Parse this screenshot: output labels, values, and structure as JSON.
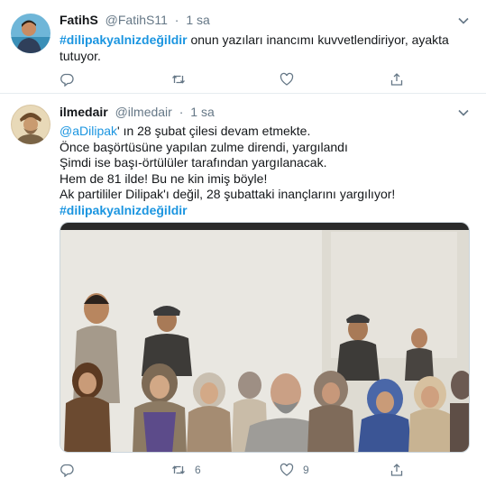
{
  "tweets": [
    {
      "author": {
        "name": "FatihS",
        "handle": "@FatihS11",
        "time": "1 sa"
      },
      "text": {
        "hashtag": "#dilipakyalnizdeğildir",
        "body": " onun yazıları inancımı kuvvetlendiriyor, ayakta tutuyor."
      },
      "actions": {
        "reply_icon": "reply-icon",
        "retweet_icon": "retweet-icon",
        "like_icon": "heart-icon",
        "share_icon": "share-icon",
        "retweets": "",
        "likes": ""
      }
    },
    {
      "author": {
        "name": "ilmedair",
        "handle": "@ilmedair",
        "time": "1 sa"
      },
      "text": {
        "mention": "@aDilipak",
        "line1": "' ın 28 şubat çilesi devam etmekte.",
        "line2": "Önce başörtüsüne yapılan zulme direndi, yargılandı",
        "line3": "Şimdi ise başı-örtülüler tarafından yargılanacak.",
        "line4": "Hem de 81 ilde! Bu ne kin imiş böyle!",
        "line5": "Ak partililer Dilipak'ı değil, 28 şubattaki inançlarını yargılıyor!",
        "hashtag": "#dilipakyalnizdeğildir"
      },
      "actions": {
        "reply_icon": "reply-icon",
        "retweet_icon": "retweet-icon",
        "like_icon": "heart-icon",
        "share_icon": "share-icon",
        "retweets": "6",
        "likes": "9"
      }
    }
  ],
  "colors": {
    "link": "#1b95e0",
    "secondary_text": "#657786",
    "divider": "#e6ecf0"
  }
}
